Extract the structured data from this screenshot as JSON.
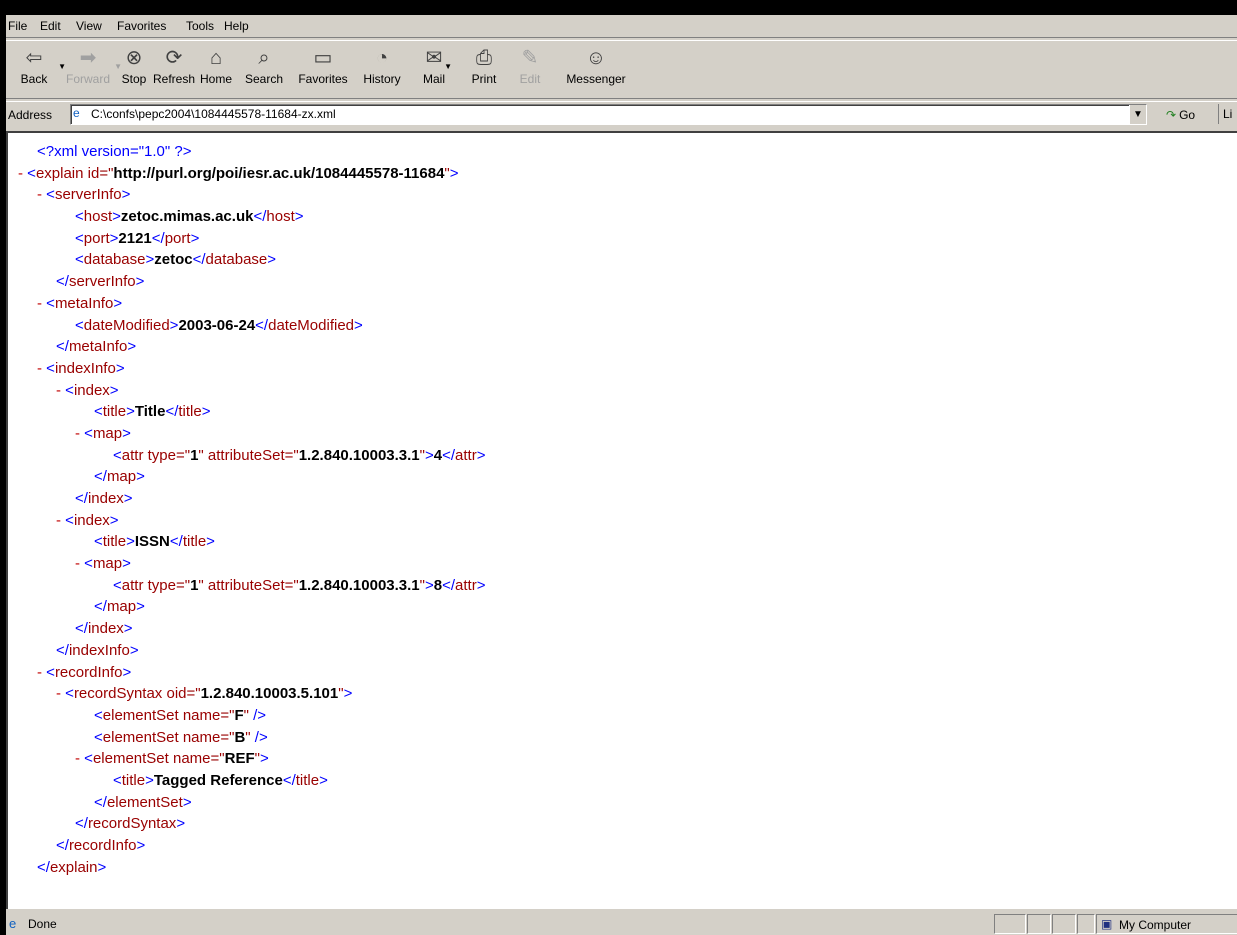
{
  "menu": [
    "File",
    "Edit",
    "View",
    "Favorites",
    "Tools",
    "Help"
  ],
  "toolbar": [
    {
      "name": "back",
      "label": "Back",
      "icon": "back-arrow-icon",
      "glyph": "⇦",
      "disabled": false
    },
    {
      "name": "forward",
      "label": "Forward",
      "icon": "forward-arrow-icon",
      "glyph": "➡",
      "disabled": true
    },
    {
      "name": "stop",
      "label": "Stop",
      "icon": "stop-icon",
      "glyph": "⊗",
      "disabled": false
    },
    {
      "name": "refresh",
      "label": "Refresh",
      "icon": "refresh-icon",
      "glyph": "⟳",
      "disabled": false
    },
    {
      "name": "home",
      "label": "Home",
      "icon": "home-icon",
      "glyph": "⌂",
      "disabled": false
    },
    {
      "name": "search",
      "label": "Search",
      "icon": "search-icon",
      "glyph": "⌕",
      "disabled": false
    },
    {
      "name": "favorites",
      "label": "Favorites",
      "icon": "favorites-folder-icon",
      "glyph": "▭",
      "disabled": false
    },
    {
      "name": "history",
      "label": "History",
      "icon": "history-icon",
      "glyph": "◔",
      "disabled": false
    },
    {
      "name": "mail",
      "label": "Mail",
      "icon": "mail-icon",
      "glyph": "✉",
      "disabled": false
    },
    {
      "name": "print",
      "label": "Print",
      "icon": "print-icon",
      "glyph": "⎙",
      "disabled": false
    },
    {
      "name": "edit",
      "label": "Edit",
      "icon": "edit-icon",
      "glyph": "✎",
      "disabled": true
    },
    {
      "name": "messenger",
      "label": "Messenger",
      "icon": "messenger-icon",
      "glyph": "☺",
      "disabled": false
    }
  ],
  "address": {
    "label": "Address",
    "url": "C:\\confs\\pepc2004\\1084445578-11684-zx.xml",
    "go": "Go",
    "links": "Li"
  },
  "xml_lines": [
    {
      "minus": false,
      "indent": 1,
      "parts": [
        {
          "c": "pi",
          "t": "<?xml version=\"1.0\" ?>"
        }
      ]
    },
    {
      "minus": true,
      "indent": 0,
      "parts": [
        {
          "c": "br",
          "t": "<"
        },
        {
          "c": "tag",
          "t": "explain"
        },
        {
          "c": "an",
          "t": " id=\""
        },
        {
          "c": "av",
          "t": "http://purl.org/poi/iesr.ac.uk/1084445578-11684"
        },
        {
          "c": "an",
          "t": "\""
        },
        {
          "c": "br",
          "t": ">"
        }
      ]
    },
    {
      "minus": true,
      "indent": 1,
      "parts": [
        {
          "c": "br",
          "t": "<"
        },
        {
          "c": "tag",
          "t": "serverInfo"
        },
        {
          "c": "br",
          "t": ">"
        }
      ]
    },
    {
      "minus": false,
      "indent": 3,
      "parts": [
        {
          "c": "br",
          "t": "<"
        },
        {
          "c": "tag",
          "t": "host"
        },
        {
          "c": "br",
          "t": ">"
        },
        {
          "c": "tx",
          "t": "zetoc.mimas.ac.uk"
        },
        {
          "c": "br",
          "t": "</"
        },
        {
          "c": "tag",
          "t": "host"
        },
        {
          "c": "br",
          "t": ">"
        }
      ]
    },
    {
      "minus": false,
      "indent": 3,
      "parts": [
        {
          "c": "br",
          "t": "<"
        },
        {
          "c": "tag",
          "t": "port"
        },
        {
          "c": "br",
          "t": ">"
        },
        {
          "c": "tx",
          "t": "2121"
        },
        {
          "c": "br",
          "t": "</"
        },
        {
          "c": "tag",
          "t": "port"
        },
        {
          "c": "br",
          "t": ">"
        }
      ]
    },
    {
      "minus": false,
      "indent": 3,
      "parts": [
        {
          "c": "br",
          "t": "<"
        },
        {
          "c": "tag",
          "t": "database"
        },
        {
          "c": "br",
          "t": ">"
        },
        {
          "c": "tx",
          "t": "zetoc"
        },
        {
          "c": "br",
          "t": "</"
        },
        {
          "c": "tag",
          "t": "database"
        },
        {
          "c": "br",
          "t": ">"
        }
      ]
    },
    {
      "minus": false,
      "indent": 2,
      "parts": [
        {
          "c": "br",
          "t": "</"
        },
        {
          "c": "tag",
          "t": "serverInfo"
        },
        {
          "c": "br",
          "t": ">"
        }
      ]
    },
    {
      "minus": true,
      "indent": 1,
      "parts": [
        {
          "c": "br",
          "t": "<"
        },
        {
          "c": "tag",
          "t": "metaInfo"
        },
        {
          "c": "br",
          "t": ">"
        }
      ]
    },
    {
      "minus": false,
      "indent": 3,
      "parts": [
        {
          "c": "br",
          "t": "<"
        },
        {
          "c": "tag",
          "t": "dateModified"
        },
        {
          "c": "br",
          "t": ">"
        },
        {
          "c": "tx",
          "t": "2003-06-24"
        },
        {
          "c": "br",
          "t": "</"
        },
        {
          "c": "tag",
          "t": "dateModified"
        },
        {
          "c": "br",
          "t": ">"
        }
      ]
    },
    {
      "minus": false,
      "indent": 2,
      "parts": [
        {
          "c": "br",
          "t": "</"
        },
        {
          "c": "tag",
          "t": "metaInfo"
        },
        {
          "c": "br",
          "t": ">"
        }
      ]
    },
    {
      "minus": true,
      "indent": 1,
      "parts": [
        {
          "c": "br",
          "t": "<"
        },
        {
          "c": "tag",
          "t": "indexInfo"
        },
        {
          "c": "br",
          "t": ">"
        }
      ]
    },
    {
      "minus": true,
      "indent": 2,
      "parts": [
        {
          "c": "br",
          "t": "<"
        },
        {
          "c": "tag",
          "t": "index"
        },
        {
          "c": "br",
          "t": ">"
        }
      ]
    },
    {
      "minus": false,
      "indent": 4,
      "parts": [
        {
          "c": "br",
          "t": "<"
        },
        {
          "c": "tag",
          "t": "title"
        },
        {
          "c": "br",
          "t": ">"
        },
        {
          "c": "tx",
          "t": "Title"
        },
        {
          "c": "br",
          "t": "</"
        },
        {
          "c": "tag",
          "t": "title"
        },
        {
          "c": "br",
          "t": ">"
        }
      ]
    },
    {
      "minus": true,
      "indent": 3,
      "parts": [
        {
          "c": "br",
          "t": "<"
        },
        {
          "c": "tag",
          "t": "map"
        },
        {
          "c": "br",
          "t": ">"
        }
      ]
    },
    {
      "minus": false,
      "indent": 5,
      "parts": [
        {
          "c": "br",
          "t": "<"
        },
        {
          "c": "tag",
          "t": "attr"
        },
        {
          "c": "an",
          "t": " type=\""
        },
        {
          "c": "av",
          "t": "1"
        },
        {
          "c": "an",
          "t": "\" attributeSet=\""
        },
        {
          "c": "av",
          "t": "1.2.840.10003.3.1"
        },
        {
          "c": "an",
          "t": "\""
        },
        {
          "c": "br",
          "t": ">"
        },
        {
          "c": "tx",
          "t": "4"
        },
        {
          "c": "br",
          "t": "</"
        },
        {
          "c": "tag",
          "t": "attr"
        },
        {
          "c": "br",
          "t": ">"
        }
      ]
    },
    {
      "minus": false,
      "indent": 4,
      "parts": [
        {
          "c": "br",
          "t": "</"
        },
        {
          "c": "tag",
          "t": "map"
        },
        {
          "c": "br",
          "t": ">"
        }
      ]
    },
    {
      "minus": false,
      "indent": 3,
      "parts": [
        {
          "c": "br",
          "t": "</"
        },
        {
          "c": "tag",
          "t": "index"
        },
        {
          "c": "br",
          "t": ">"
        }
      ]
    },
    {
      "minus": true,
      "indent": 2,
      "parts": [
        {
          "c": "br",
          "t": "<"
        },
        {
          "c": "tag",
          "t": "index"
        },
        {
          "c": "br",
          "t": ">"
        }
      ]
    },
    {
      "minus": false,
      "indent": 4,
      "parts": [
        {
          "c": "br",
          "t": "<"
        },
        {
          "c": "tag",
          "t": "title"
        },
        {
          "c": "br",
          "t": ">"
        },
        {
          "c": "tx",
          "t": "ISSN"
        },
        {
          "c": "br",
          "t": "</"
        },
        {
          "c": "tag",
          "t": "title"
        },
        {
          "c": "br",
          "t": ">"
        }
      ]
    },
    {
      "minus": true,
      "indent": 3,
      "parts": [
        {
          "c": "br",
          "t": "<"
        },
        {
          "c": "tag",
          "t": "map"
        },
        {
          "c": "br",
          "t": ">"
        }
      ]
    },
    {
      "minus": false,
      "indent": 5,
      "parts": [
        {
          "c": "br",
          "t": "<"
        },
        {
          "c": "tag",
          "t": "attr"
        },
        {
          "c": "an",
          "t": " type=\""
        },
        {
          "c": "av",
          "t": "1"
        },
        {
          "c": "an",
          "t": "\" attributeSet=\""
        },
        {
          "c": "av",
          "t": "1.2.840.10003.3.1"
        },
        {
          "c": "an",
          "t": "\""
        },
        {
          "c": "br",
          "t": ">"
        },
        {
          "c": "tx",
          "t": "8"
        },
        {
          "c": "br",
          "t": "</"
        },
        {
          "c": "tag",
          "t": "attr"
        },
        {
          "c": "br",
          "t": ">"
        }
      ]
    },
    {
      "minus": false,
      "indent": 4,
      "parts": [
        {
          "c": "br",
          "t": "</"
        },
        {
          "c": "tag",
          "t": "map"
        },
        {
          "c": "br",
          "t": ">"
        }
      ]
    },
    {
      "minus": false,
      "indent": 3,
      "parts": [
        {
          "c": "br",
          "t": "</"
        },
        {
          "c": "tag",
          "t": "index"
        },
        {
          "c": "br",
          "t": ">"
        }
      ]
    },
    {
      "minus": false,
      "indent": 2,
      "parts": [
        {
          "c": "br",
          "t": "</"
        },
        {
          "c": "tag",
          "t": "indexInfo"
        },
        {
          "c": "br",
          "t": ">"
        }
      ]
    },
    {
      "minus": true,
      "indent": 1,
      "parts": [
        {
          "c": "br",
          "t": "<"
        },
        {
          "c": "tag",
          "t": "recordInfo"
        },
        {
          "c": "br",
          "t": ">"
        }
      ]
    },
    {
      "minus": true,
      "indent": 2,
      "parts": [
        {
          "c": "br",
          "t": "<"
        },
        {
          "c": "tag",
          "t": "recordSyntax"
        },
        {
          "c": "an",
          "t": " oid=\""
        },
        {
          "c": "av",
          "t": "1.2.840.10003.5.101"
        },
        {
          "c": "an",
          "t": "\""
        },
        {
          "c": "br",
          "t": ">"
        }
      ]
    },
    {
      "minus": false,
      "indent": 4,
      "parts": [
        {
          "c": "br",
          "t": "<"
        },
        {
          "c": "tag",
          "t": "elementSet"
        },
        {
          "c": "an",
          "t": " name=\""
        },
        {
          "c": "av",
          "t": "F"
        },
        {
          "c": "an",
          "t": "\""
        },
        {
          "c": "br",
          "t": " />"
        }
      ]
    },
    {
      "minus": false,
      "indent": 4,
      "parts": [
        {
          "c": "br",
          "t": "<"
        },
        {
          "c": "tag",
          "t": "elementSet"
        },
        {
          "c": "an",
          "t": " name=\""
        },
        {
          "c": "av",
          "t": "B"
        },
        {
          "c": "an",
          "t": "\""
        },
        {
          "c": "br",
          "t": " />"
        }
      ]
    },
    {
      "minus": true,
      "indent": 3,
      "parts": [
        {
          "c": "br",
          "t": "<"
        },
        {
          "c": "tag",
          "t": "elementSet"
        },
        {
          "c": "an",
          "t": " name=\""
        },
        {
          "c": "av",
          "t": "REF"
        },
        {
          "c": "an",
          "t": "\""
        },
        {
          "c": "br",
          "t": ">"
        }
      ]
    },
    {
      "minus": false,
      "indent": 5,
      "parts": [
        {
          "c": "br",
          "t": "<"
        },
        {
          "c": "tag",
          "t": "title"
        },
        {
          "c": "br",
          "t": ">"
        },
        {
          "c": "tx",
          "t": "Tagged Reference"
        },
        {
          "c": "br",
          "t": "</"
        },
        {
          "c": "tag",
          "t": "title"
        },
        {
          "c": "br",
          "t": ">"
        }
      ]
    },
    {
      "minus": false,
      "indent": 4,
      "parts": [
        {
          "c": "br",
          "t": "</"
        },
        {
          "c": "tag",
          "t": "elementSet"
        },
        {
          "c": "br",
          "t": ">"
        }
      ]
    },
    {
      "minus": false,
      "indent": 3,
      "parts": [
        {
          "c": "br",
          "t": "</"
        },
        {
          "c": "tag",
          "t": "recordSyntax"
        },
        {
          "c": "br",
          "t": ">"
        }
      ]
    },
    {
      "minus": false,
      "indent": 2,
      "parts": [
        {
          "c": "br",
          "t": "</"
        },
        {
          "c": "tag",
          "t": "recordInfo"
        },
        {
          "c": "br",
          "t": ">"
        }
      ]
    },
    {
      "minus": false,
      "indent": 1,
      "parts": [
        {
          "c": "br",
          "t": "</"
        },
        {
          "c": "tag",
          "t": "explain"
        },
        {
          "c": "br",
          "t": ">"
        }
      ]
    }
  ],
  "status": {
    "text": "Done",
    "zone": "My Computer"
  },
  "colors": {
    "chrome": "#d4d0c8",
    "xml_markup": "#0000ff",
    "xml_tag": "#990000",
    "xml_minus": "#c00000"
  }
}
